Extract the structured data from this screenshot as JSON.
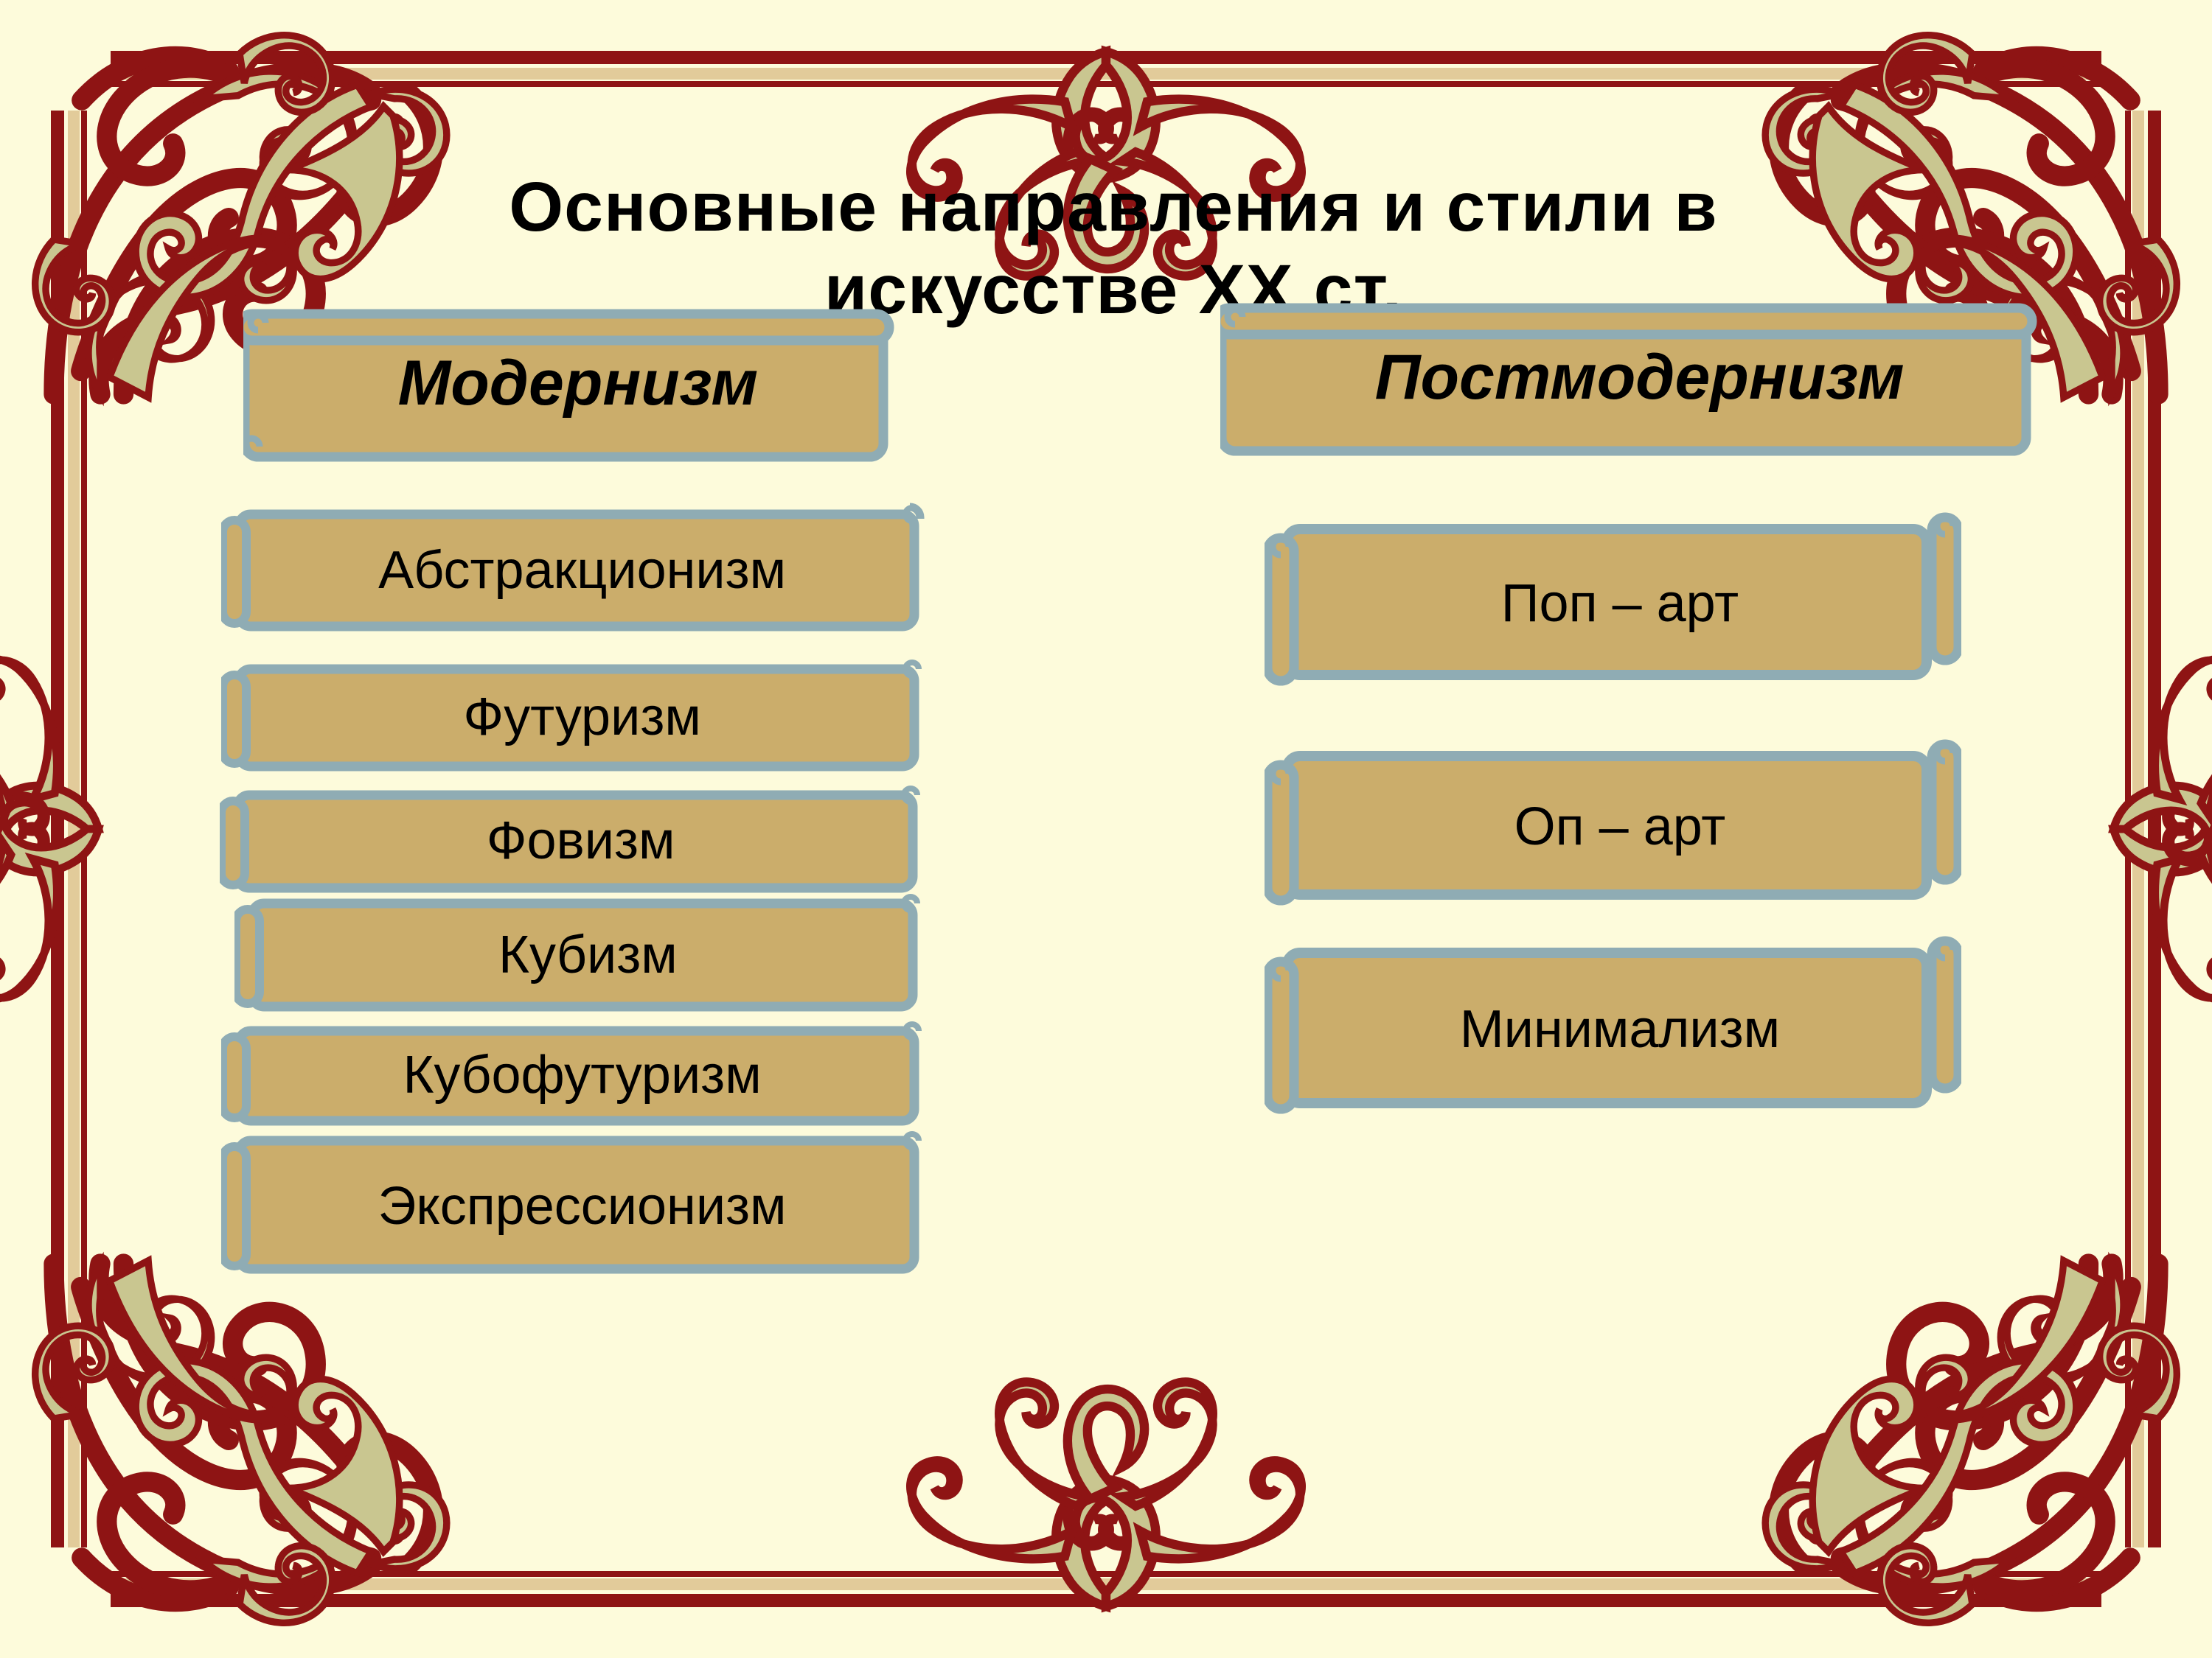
{
  "slide": {
    "background_color": "#FDFBDB",
    "frame": {
      "accent_dark_red": "#8E1414",
      "accent_sage": "#C9C690",
      "accent_tan": "#E2CB9A"
    }
  },
  "title": {
    "line1": "Основные направления и стили  в",
    "line2": "искусстве XX ст."
  },
  "columns": [
    {
      "header": "Модернизм",
      "items": [
        {
          "label": "Абстракционизм"
        },
        {
          "label": "Футуризм"
        },
        {
          "label": "Фовизм"
        },
        {
          "label": "Кубизм"
        },
        {
          "label": "Кубофутуризм"
        },
        {
          "label": "Экспрессионизм"
        }
      ]
    },
    {
      "header": "Постмодернизм",
      "items": [
        {
          "label": "Поп – арт"
        },
        {
          "label": "Оп – арт"
        },
        {
          "label": "Минимализм"
        }
      ]
    }
  ],
  "shape_style": {
    "fill": "#CBAD6B",
    "outline": "#8FACB4",
    "text_color": "#000000",
    "shape_name": "horizontal-scroll"
  }
}
